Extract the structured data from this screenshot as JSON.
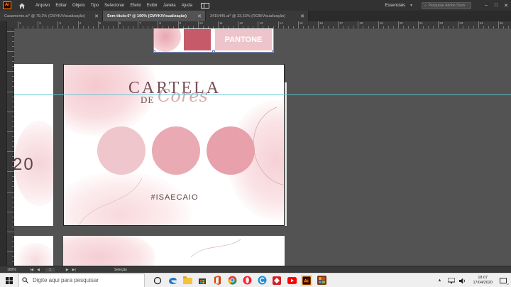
{
  "menubar": {
    "logo": "Ai",
    "items": [
      "Arquivo",
      "Editar",
      "Objeto",
      "Tipo",
      "Selecionar",
      "Efeito",
      "Exibir",
      "Janela",
      "Ajuda"
    ],
    "workspace": "Essenciais",
    "search_placeholder": "Pesquisar Adobe Stock"
  },
  "tabs": [
    {
      "label": "Casamento.ai* @ 79,2% (CMYK/Visualização)",
      "active": false
    },
    {
      "label": "Sem título-6* @ 100% (CMYK/Visualização)",
      "active": true
    },
    {
      "label": "3415445.ai* @ 33,33% (RGB/Visualização)",
      "active": false
    }
  ],
  "ruler_labels": [
    "1",
    "2",
    "3",
    "4",
    "5",
    "6",
    "7",
    "8",
    "9",
    "10",
    "11",
    "12",
    "13",
    "14",
    "15",
    "16",
    "17",
    "18",
    "19",
    "20",
    "21",
    "22",
    "23",
    "24",
    "25"
  ],
  "artwork": {
    "pantone_label": "PANTONE",
    "title": "CARTELA",
    "subtitle_prefix": "DE",
    "subtitle_script": "Cores",
    "hashtag": "#ISAECAIO",
    "partial_text": "20",
    "swatches": [
      "#eec6cb",
      "#eaaab3",
      "#e8a0aa"
    ]
  },
  "statusbar": {
    "zoom": "100%",
    "page": "1",
    "tool": "Seleção"
  },
  "taskbar": {
    "search_placeholder": "Digite aqui para pesquisar",
    "time": "18:07",
    "date": "17/04/2020",
    "notifications": "2"
  },
  "colors": {
    "accent": "#ff9a00",
    "guide": "#5fc7cf",
    "title": "#7a4e53"
  }
}
